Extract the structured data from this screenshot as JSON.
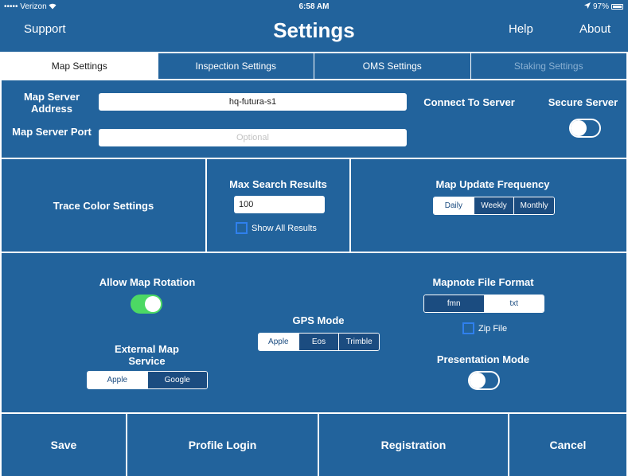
{
  "colors": {
    "primary": "#22639c",
    "segment_dark": "#1b4c80",
    "toggle_on": "#4cd964",
    "checkbox_border": "#2f80ed"
  },
  "status_bar": {
    "carrier": "••••• Verizon",
    "wifi_icon": "wifi-icon",
    "time": "6:58 AM",
    "location_icon": "location-arrow-icon",
    "battery": "97%"
  },
  "nav": {
    "left": "Support",
    "title": "Settings",
    "help": "Help",
    "about": "About"
  },
  "tabs": [
    {
      "label": "Map Settings",
      "state": "active"
    },
    {
      "label": "Inspection Settings",
      "state": "normal"
    },
    {
      "label": "OMS Settings",
      "state": "normal"
    },
    {
      "label": "Staking Settings",
      "state": "disabled"
    }
  ],
  "server": {
    "address_label": "Map Server Address",
    "address_value": "hq-futura-s1",
    "port_label": "Map Server Port",
    "port_placeholder": "Optional",
    "connect_label": "Connect To Server",
    "secure_label": "Secure Server",
    "secure_on": false
  },
  "trace": {
    "label": "Trace Color Settings"
  },
  "search": {
    "label": "Max Search Results",
    "value": "100",
    "show_all": "Show All Results",
    "show_all_checked": false
  },
  "update": {
    "label": "Map Update Frequency",
    "options": [
      "Daily",
      "Weekly",
      "Monthly"
    ],
    "selected": "Daily"
  },
  "rotation": {
    "label": "Allow Map Rotation",
    "on": true
  },
  "external": {
    "label": "External Map Service",
    "options": [
      "Apple",
      "Google"
    ],
    "selected": "Apple"
  },
  "gps": {
    "label": "GPS Mode",
    "options": [
      "Apple",
      "Eos",
      "Trimble"
    ],
    "selected": "Apple"
  },
  "mapnote": {
    "label": "Mapnote File Format",
    "options": [
      "fmn",
      "txt"
    ],
    "selected": "txt",
    "zip_label": "Zip File",
    "zip_checked": false
  },
  "presentation": {
    "label": "Presentation Mode",
    "on": false
  },
  "footer": {
    "save": "Save",
    "profile": "Profile Login",
    "registration": "Registration",
    "cancel": "Cancel"
  }
}
